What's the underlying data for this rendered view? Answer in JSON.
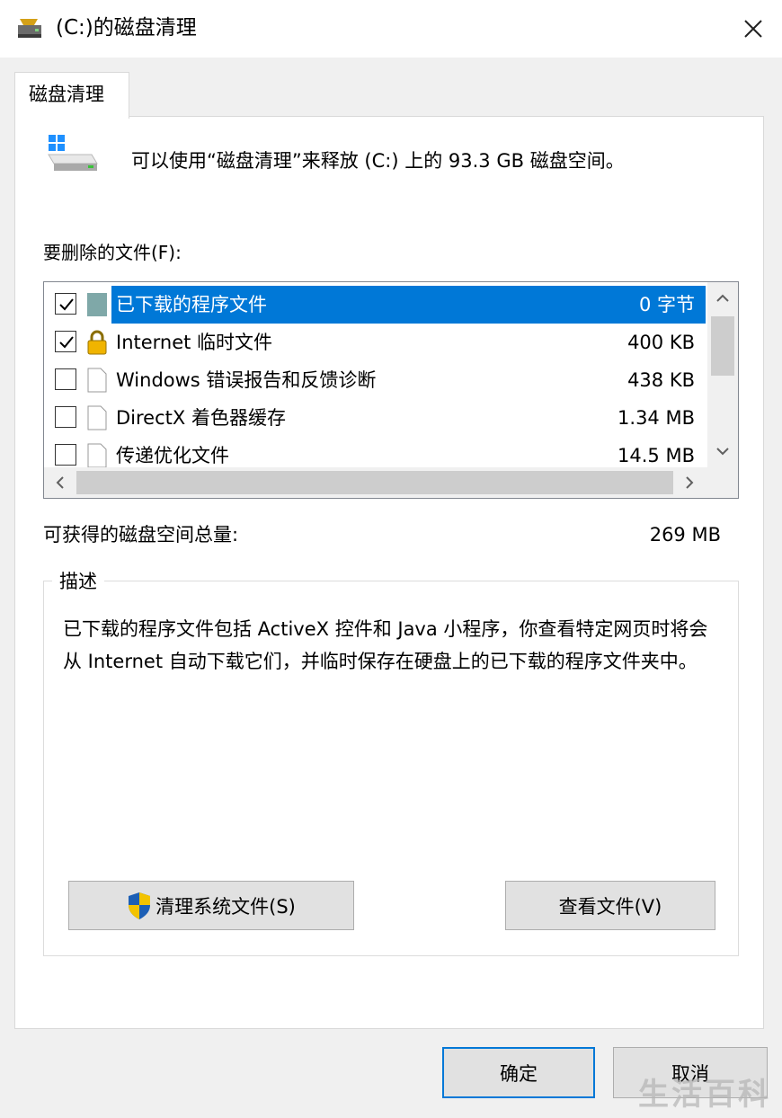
{
  "window": {
    "title": "(C:)的磁盘清理",
    "close_icon": "close-icon"
  },
  "tab": {
    "label": "磁盘清理"
  },
  "intro": {
    "text": "可以使用“磁盘清理”来释放 (C:) 上的 93.3 GB 磁盘空间。"
  },
  "files_list": {
    "label": "要删除的文件(F):",
    "items": [
      {
        "name": "已下载的程序文件",
        "size": "0 字节",
        "checked": true,
        "selected": true,
        "icon": "folder-icon"
      },
      {
        "name": "Internet 临时文件",
        "size": "400 KB",
        "checked": true,
        "selected": false,
        "icon": "lock-icon"
      },
      {
        "name": "Windows 错误报告和反馈诊断",
        "size": "438 KB",
        "checked": false,
        "selected": false,
        "icon": "file-icon"
      },
      {
        "name": "DirectX 着色器缓存",
        "size": "1.34 MB",
        "checked": false,
        "selected": false,
        "icon": "file-icon"
      },
      {
        "name": "传递优化文件",
        "size": "14.5 MB",
        "checked": false,
        "selected": false,
        "icon": "file-icon"
      }
    ]
  },
  "total": {
    "label": "可获得的磁盘空间总量:",
    "value": "269 MB"
  },
  "description": {
    "legend": "描述",
    "text": "已下载的程序文件包括 ActiveX 控件和 Java 小程序，你查看特定网页时将会从 Internet 自动下载它们，并临时保存在硬盘上的已下载的程序文件夹中。"
  },
  "buttons": {
    "clean_system": "清理系统文件(S)",
    "view_files": "查看文件(V)",
    "ok": "确定",
    "cancel": "取消"
  },
  "watermark": "生活百科",
  "colors": {
    "selection": "#0078d7",
    "default_button_border": "#0078d7"
  }
}
